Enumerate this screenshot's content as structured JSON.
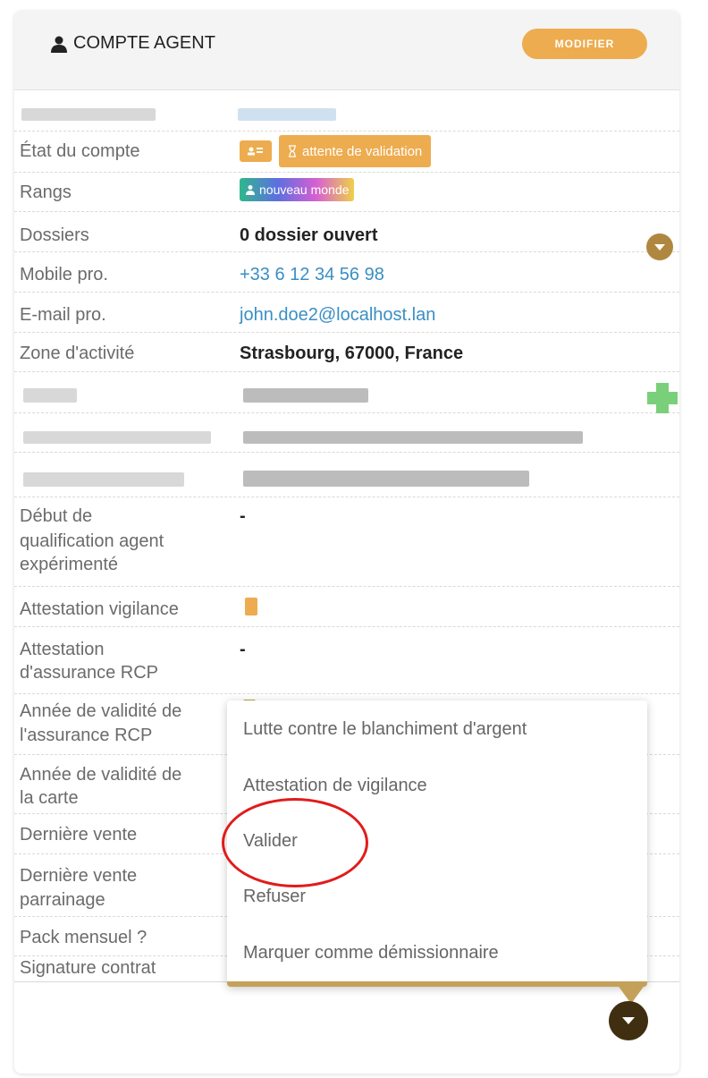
{
  "card": {
    "title": "COMPTE AGENT",
    "modify_label": "MODIFIER"
  },
  "rows": {
    "etat": {
      "label": "État du compte",
      "status": "attente de validation"
    },
    "rangs": {
      "label": "Rangs",
      "rank": "nouveau monde"
    },
    "dossiers": {
      "label": "Dossiers",
      "value": "0 dossier ouvert"
    },
    "mobile": {
      "label": "Mobile pro.",
      "value": "+33 6 12 34 56 98"
    },
    "email": {
      "label": "E-mail pro.",
      "value": "john.doe2@localhost.lan"
    },
    "zone": {
      "label": "Zone d'activité",
      "value": "Strasbourg, 67000, France"
    },
    "debut": {
      "label_1": "Début de",
      "label_2": "qualification agent",
      "label_3": "expérimenté",
      "value": "-"
    },
    "vigilance": {
      "label": "Attestation vigilance"
    },
    "assurance": {
      "label_1": "Attestation",
      "label_2": "d'assurance RCP",
      "value": "-"
    },
    "annee_rcp": {
      "label_1": "Année de validité de",
      "label_2": "l'assurance RCP"
    },
    "annee_carte": {
      "label_1": "Année de validité de",
      "label_2": "la carte"
    },
    "derniere_vente": {
      "label": "Dernière vente"
    },
    "derniere_parrainage": {
      "label_1": "Dernière vente",
      "label_2": "parrainage"
    },
    "pack": {
      "label": "Pack mensuel ?"
    },
    "signature": {
      "label": "Signature contrat"
    }
  },
  "menu": {
    "items": [
      "Lutte contre le blanchiment d'argent",
      "Attestation de vigilance",
      "Valider",
      "Refuser",
      "Marquer comme démissionnaire"
    ]
  },
  "colors": {
    "accent": "#edac4f",
    "link": "#3a8fc4",
    "toggle": "#b0873e",
    "highlight": "#e11b1b"
  }
}
